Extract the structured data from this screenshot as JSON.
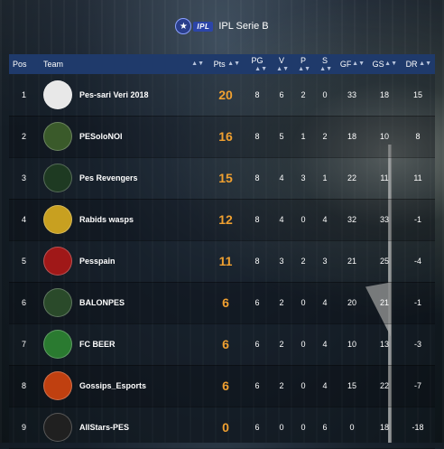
{
  "header": {
    "logo_text": "IPL",
    "logo_star": "★",
    "title": "IPL Serie B"
  },
  "columns": {
    "pos": "Pos",
    "team": "Team",
    "pts": "Pts",
    "pg": "PG",
    "v": "V",
    "p": "P",
    "s": "S",
    "gf": "GF",
    "gs": "GS",
    "dr": "DR"
  },
  "rows": [
    {
      "pos": "1",
      "team": "Pes-sari Veri 2018",
      "crest_icon": "striped-shield-crest-icon",
      "pts": "20",
      "pg": "8",
      "v": "6",
      "p": "2",
      "s": "0",
      "gf": "33",
      "gs": "18",
      "dr": "15"
    },
    {
      "pos": "2",
      "team": "PESoloNOI",
      "crest_icon": "green-round-crest-icon",
      "pts": "16",
      "pg": "8",
      "v": "5",
      "p": "1",
      "s": "2",
      "gf": "18",
      "gs": "10",
      "dr": "8"
    },
    {
      "pos": "3",
      "team": "Pes Revengers",
      "crest_icon": "skull-crest-icon",
      "pts": "15",
      "pg": "8",
      "v": "4",
      "p": "3",
      "s": "1",
      "gf": "22",
      "gs": "11",
      "dr": "11"
    },
    {
      "pos": "4",
      "team": "Rabids wasps",
      "crest_icon": "wasp-crest-icon",
      "pts": "12",
      "pg": "8",
      "v": "4",
      "p": "0",
      "s": "4",
      "gf": "32",
      "gs": "33",
      "dr": "-1"
    },
    {
      "pos": "5",
      "team": "Pesspain",
      "crest_icon": "red-round-crest-icon",
      "pts": "11",
      "pg": "8",
      "v": "3",
      "p": "2",
      "s": "3",
      "gf": "21",
      "gs": "25",
      "dr": "-4"
    },
    {
      "pos": "6",
      "team": "BALONPES",
      "crest_icon": "balonpes-crest-icon",
      "pts": "6",
      "pg": "6",
      "v": "2",
      "p": "0",
      "s": "4",
      "gf": "20",
      "gs": "21",
      "dr": "-1"
    },
    {
      "pos": "7",
      "team": "FC BEER",
      "crest_icon": "beer-ball-crest-icon",
      "pts": "6",
      "pg": "6",
      "v": "2",
      "p": "0",
      "s": "4",
      "gf": "10",
      "gs": "13",
      "dr": "-3"
    },
    {
      "pos": "8",
      "team": "Gossips_Esports",
      "crest_icon": "flame-crest-icon",
      "pts": "6",
      "pg": "6",
      "v": "2",
      "p": "0",
      "s": "4",
      "gf": "15",
      "gs": "22",
      "dr": "-7"
    },
    {
      "pos": "9",
      "team": "AllStars-PES",
      "crest_icon": "allstars-crest-icon",
      "pts": "0",
      "pg": "6",
      "v": "0",
      "p": "0",
      "s": "6",
      "gf": "0",
      "gs": "18",
      "dr": "-18"
    }
  ],
  "colors": {
    "header_row": "#1f3a6b",
    "points": "#f0a030",
    "crests": [
      "#e8e8e8",
      "#3a5a2a",
      "#1e3a22",
      "#c8a020",
      "#a01818",
      "#2a4a2a",
      "#2a7a30",
      "#c04010",
      "#202020"
    ]
  }
}
